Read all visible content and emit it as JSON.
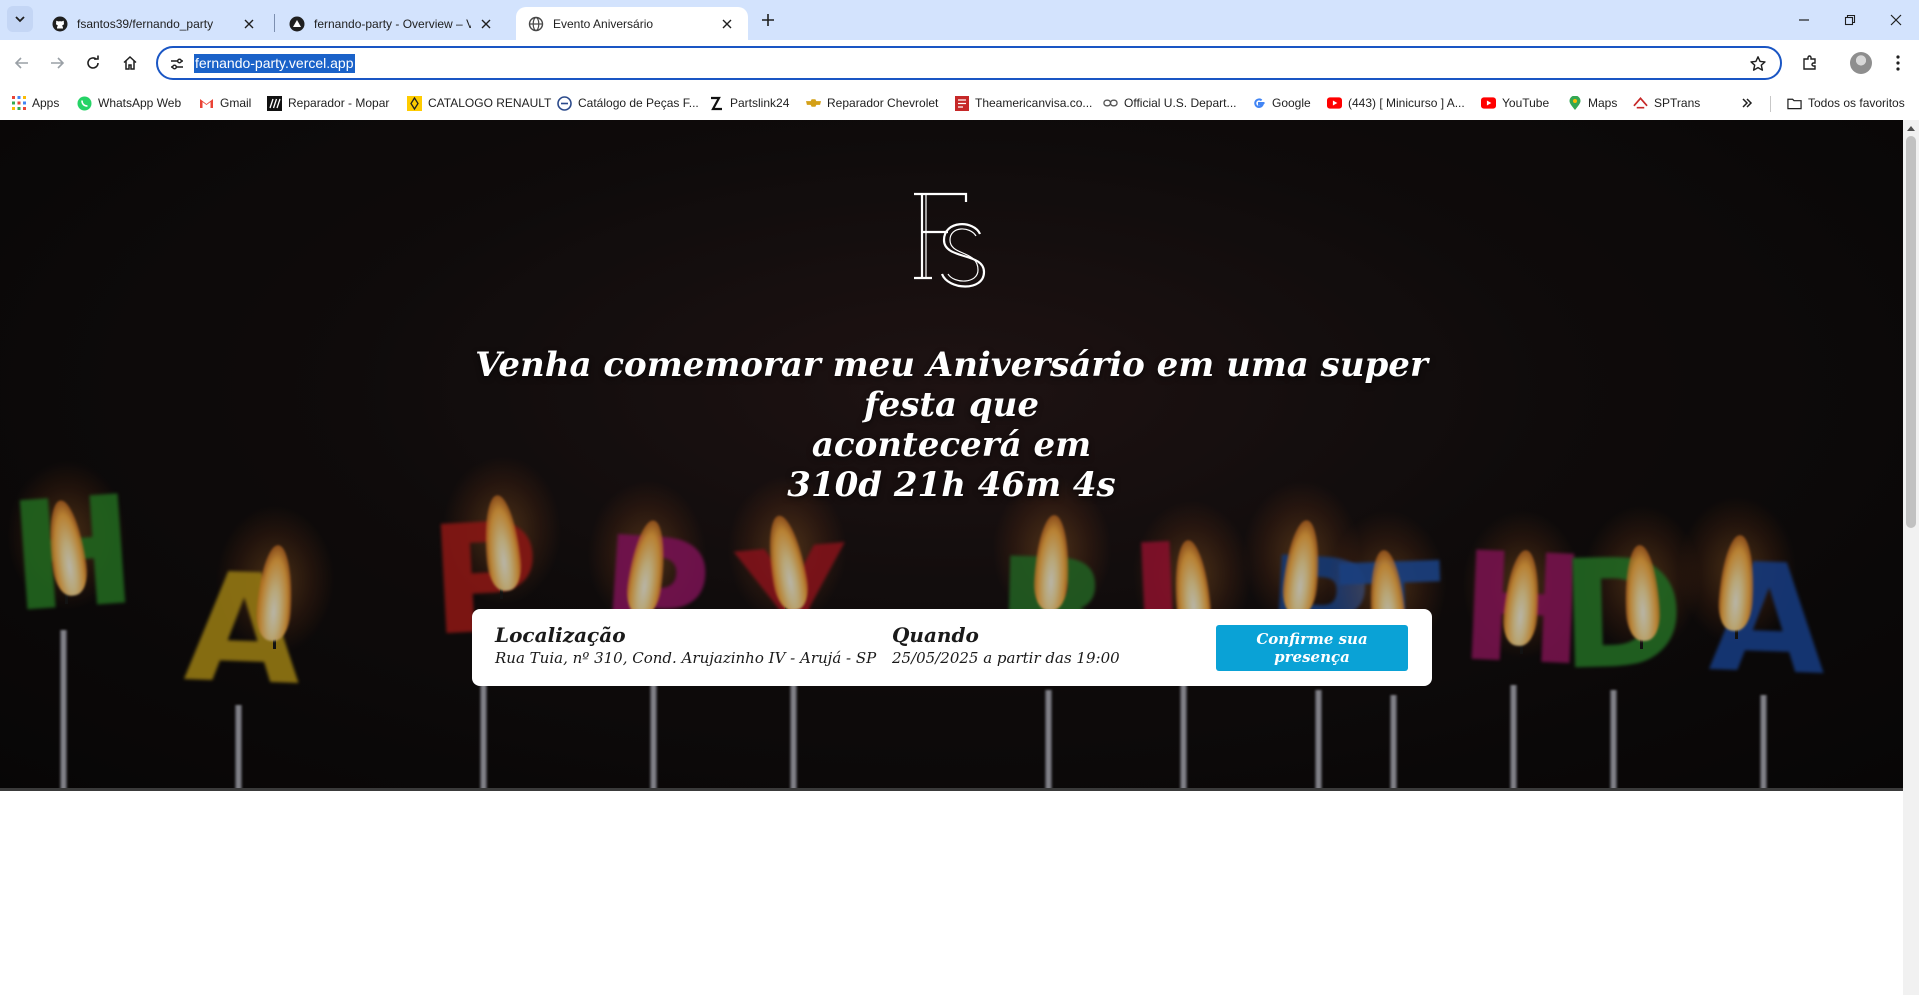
{
  "browser": {
    "tabs": [
      {
        "title": "fsantos39/fernando_party",
        "icon": "github-icon"
      },
      {
        "title": "fernando-party - Overview – Vercel",
        "icon": "vercel-icon"
      },
      {
        "title": "Evento Aniversário",
        "icon": "globe-icon"
      }
    ],
    "active_tab": 2,
    "url": "fernando-party.vercel.app",
    "bookmarks": [
      {
        "label": "Apps",
        "icon": "apps-grid-icon"
      },
      {
        "label": "WhatsApp Web",
        "icon": "whatsapp-icon"
      },
      {
        "label": "Gmail",
        "icon": "gmail-icon"
      },
      {
        "label": "Reparador - Mopar",
        "icon": "mopar-icon"
      },
      {
        "label": "CATALOGO RENAULT",
        "icon": "renault-icon"
      },
      {
        "label": "Catálogo de Peças F...",
        "icon": "parts-catalog-icon"
      },
      {
        "label": "Partslink24",
        "icon": "partslink-icon"
      },
      {
        "label": "Reparador Chevrolet",
        "icon": "chevrolet-icon"
      },
      {
        "label": "Theamericanvisa.co...",
        "icon": "visa-site-icon"
      },
      {
        "label": "Official U.S. Depart...",
        "icon": "link-icon"
      },
      {
        "label": "Google",
        "icon": "google-icon"
      },
      {
        "label": "(443) [ Minicurso ] A...",
        "icon": "youtube-icon"
      },
      {
        "label": "YouTube",
        "icon": "youtube-icon"
      },
      {
        "label": "Maps",
        "icon": "maps-icon"
      },
      {
        "label": "SPTrans",
        "icon": "sptrans-icon"
      }
    ],
    "all_bookmarks_label": "Todos os favoritos"
  },
  "page": {
    "logo_text": "FS",
    "headline": {
      "line1": "Venha comemorar meu Aniversário em uma super festa que",
      "line2": "acontecerá em",
      "countdown": "310d 21h 46m 4s"
    },
    "location": {
      "heading": "Localização",
      "value": "Rua Tuia, nº 310, Cond. Arujazinho IV - Arujá - SP"
    },
    "when": {
      "heading": "Quando",
      "value": "25/05/2025 a partir das 19:00"
    },
    "rsvp_label": "Confirme sua presença",
    "background_letters": [
      "H",
      "A",
      "P",
      "P",
      "Y",
      "B",
      "I",
      "R",
      "T",
      "H",
      "D",
      "A"
    ],
    "colors": {
      "rsvp_button": "#0aa2d6",
      "omnibox_focus": "#1a56c4",
      "tabstrip": "#d3e3fd"
    }
  }
}
